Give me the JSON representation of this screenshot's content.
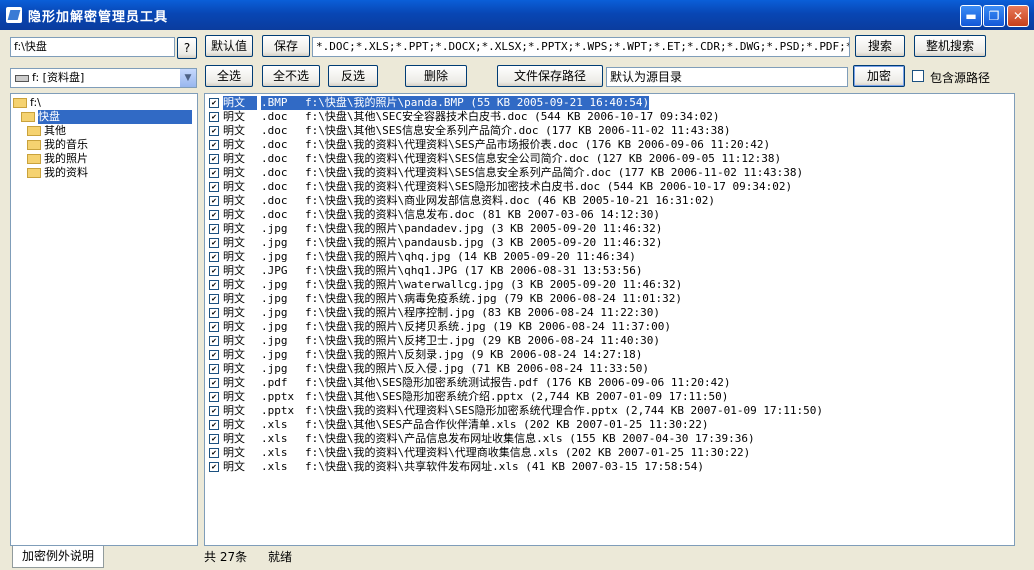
{
  "window": {
    "title": "隐形加解密管理员工具"
  },
  "path_input": "f:\\快盘",
  "buttons": {
    "help": "?",
    "default": "默认值",
    "save": "保存",
    "search": "搜索",
    "search_all": "整机搜索",
    "select_all": "全选",
    "select_none": "全不选",
    "invert": "反选",
    "delete": "删除",
    "save_path": "文件保存路径",
    "encrypt": "加密"
  },
  "ext_input": "*.DOC;*.XLS;*.PPT;*.DOCX;*.XLSX;*.PPTX;*.WPS;*.WPT;*.ET;*.CDR;*.DWG;*.PSD;*.PDF;*.BMP;*.JPG",
  "drive_select": "f: [资料盘]",
  "save_dir": "默认为源目录",
  "include_path_label": "包含源路径",
  "tree": {
    "root": "f:\\",
    "selected": "快盘",
    "children": [
      "其他",
      "我的音乐",
      "我的照片",
      "我的资料"
    ]
  },
  "files": [
    {
      "mark": "✔",
      "type": "明文",
      "ext": ".BMP",
      "info": "f:\\快盘\\我的照片\\panda.BMP (55 KB 2005-09-21 16:40:54)"
    },
    {
      "mark": "✔",
      "type": "明文",
      "ext": ".doc",
      "info": "f:\\快盘\\其他\\SEC安全容器技术白皮书.doc (544 KB 2006-10-17 09:34:02)"
    },
    {
      "mark": "✔",
      "type": "明文",
      "ext": ".doc",
      "info": "f:\\快盘\\其他\\SES信息安全系列产品简介.doc (177 KB 2006-11-02 11:43:38)"
    },
    {
      "mark": "✔",
      "type": "明文",
      "ext": ".doc",
      "info": "f:\\快盘\\我的资料\\代理资料\\SES产品市场报价表.doc (176 KB 2006-09-06 11:20:42)"
    },
    {
      "mark": "✔",
      "type": "明文",
      "ext": ".doc",
      "info": "f:\\快盘\\我的资料\\代理资料\\SES信息安全公司简介.doc (127 KB 2006-09-05 11:12:38)"
    },
    {
      "mark": "✔",
      "type": "明文",
      "ext": ".doc",
      "info": "f:\\快盘\\我的资料\\代理资料\\SES信息安全系列产品简介.doc (177 KB 2006-11-02 11:43:38)"
    },
    {
      "mark": "✔",
      "type": "明文",
      "ext": ".doc",
      "info": "f:\\快盘\\我的资料\\代理资料\\SES隐形加密技术白皮书.doc (544 KB 2006-10-17 09:34:02)"
    },
    {
      "mark": "✔",
      "type": "明文",
      "ext": ".doc",
      "info": "f:\\快盘\\我的资料\\商业网发部信息资料.doc (46 KB 2005-10-21 16:31:02)"
    },
    {
      "mark": "✔",
      "type": "明文",
      "ext": ".doc",
      "info": "f:\\快盘\\我的资料\\信息发布.doc (81 KB 2007-03-06 14:12:30)"
    },
    {
      "mark": "✔",
      "type": "明文",
      "ext": ".jpg",
      "info": "f:\\快盘\\我的照片\\pandadev.jpg (3 KB 2005-09-20 11:46:32)"
    },
    {
      "mark": "✔",
      "type": "明文",
      "ext": ".jpg",
      "info": "f:\\快盘\\我的照片\\pandausb.jpg (3 KB 2005-09-20 11:46:32)"
    },
    {
      "mark": "✔",
      "type": "明文",
      "ext": ".jpg",
      "info": "f:\\快盘\\我的照片\\qhq.jpg (14 KB 2005-09-20 11:46:34)"
    },
    {
      "mark": "✔",
      "type": "明文",
      "ext": ".JPG",
      "info": "f:\\快盘\\我的照片\\qhq1.JPG (17 KB 2006-08-31 13:53:56)"
    },
    {
      "mark": "✔",
      "type": "明文",
      "ext": ".jpg",
      "info": "f:\\快盘\\我的照片\\waterwallcg.jpg (3 KB 2005-09-20 11:46:32)"
    },
    {
      "mark": "✔",
      "type": "明文",
      "ext": ".jpg",
      "info": "f:\\快盘\\我的照片\\病毒免疫系统.jpg (79 KB 2006-08-24 11:01:32)"
    },
    {
      "mark": "✔",
      "type": "明文",
      "ext": ".jpg",
      "info": "f:\\快盘\\我的照片\\程序控制.jpg (83 KB 2006-08-24 11:22:30)"
    },
    {
      "mark": "✔",
      "type": "明文",
      "ext": ".jpg",
      "info": "f:\\快盘\\我的照片\\反拷贝系统.jpg (19 KB 2006-08-24 11:37:00)"
    },
    {
      "mark": "✔",
      "type": "明文",
      "ext": ".jpg",
      "info": "f:\\快盘\\我的照片\\反拷卫士.jpg (29 KB 2006-08-24 11:40:30)"
    },
    {
      "mark": "✔",
      "type": "明文",
      "ext": ".jpg",
      "info": "f:\\快盘\\我的照片\\反刻录.jpg (9 KB 2006-08-24 14:27:18)"
    },
    {
      "mark": "✔",
      "type": "明文",
      "ext": ".jpg",
      "info": "f:\\快盘\\我的照片\\反入侵.jpg (71 KB 2006-08-24 11:33:50)"
    },
    {
      "mark": "✔",
      "type": "明文",
      "ext": ".pdf",
      "info": "f:\\快盘\\其他\\SES隐形加密系统测试报告.pdf (176 KB 2006-09-06 11:20:42)"
    },
    {
      "mark": "✔",
      "type": "明文",
      "ext": ".pptx",
      "info": "f:\\快盘\\其他\\SES隐形加密系统介绍.pptx (2,744 KB 2007-01-09 17:11:50)"
    },
    {
      "mark": "✔",
      "type": "明文",
      "ext": ".pptx",
      "info": "f:\\快盘\\我的资料\\代理资料\\SES隐形加密系统代理合作.pptx (2,744 KB 2007-01-09 17:11:50)"
    },
    {
      "mark": "✔",
      "type": "明文",
      "ext": ".xls",
      "info": "f:\\快盘\\其他\\SES产品合作伙伴清单.xls (202 KB 2007-01-25 11:30:22)"
    },
    {
      "mark": "✔",
      "type": "明文",
      "ext": ".xls",
      "info": "f:\\快盘\\我的资料\\产品信息发布网址收集信息.xls (155 KB 2007-04-30 17:39:36)"
    },
    {
      "mark": "✔",
      "type": "明文",
      "ext": ".xls",
      "info": "f:\\快盘\\我的资料\\代理资料\\代理商收集信息.xls (202 KB 2007-01-25 11:30:22)"
    },
    {
      "mark": "✔",
      "type": "明文",
      "ext": ".xls",
      "info": "f:\\快盘\\我的资料\\共享软件发布网址.xls (41 KB 2007-03-15 17:58:54)"
    }
  ],
  "status": {
    "count": "共 27条",
    "state": "就绪"
  },
  "bottom_tab": "加密例外说明",
  "colors": {
    "selection": "#316ac5",
    "titlebar": "#0846b4",
    "face": "#ece9d8"
  }
}
